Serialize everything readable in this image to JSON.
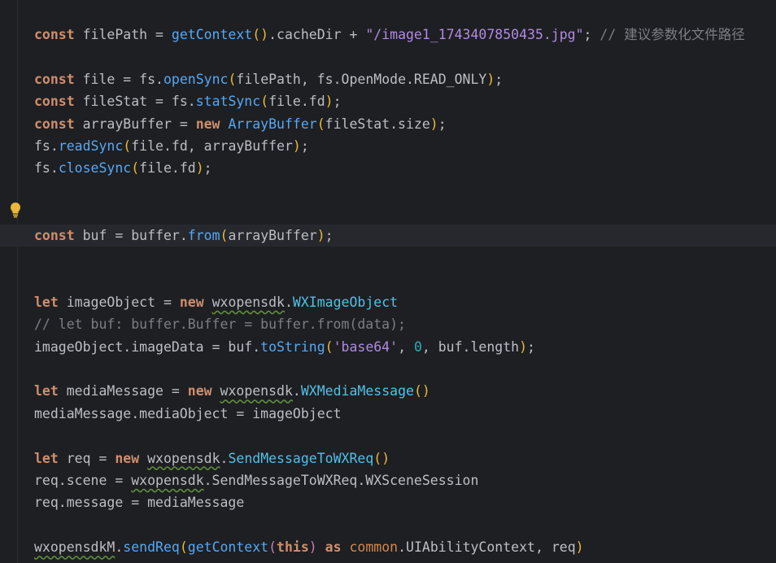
{
  "editor": {
    "lines": [
      {
        "tokens": [
          {
            "t": "const",
            "c": "kw"
          },
          {
            "t": " filePath ",
            "c": "ident"
          },
          {
            "t": "=",
            "c": "ident"
          },
          {
            "t": " ",
            "c": "ident"
          },
          {
            "t": "getContext",
            "c": "fn"
          },
          {
            "t": "()",
            "c": "yellowpar"
          },
          {
            "t": ".cacheDir ",
            "c": "ident"
          },
          {
            "t": "+",
            "c": "ident"
          },
          {
            "t": " ",
            "c": "ident"
          },
          {
            "t": "\"/image1_1743407850435.jpg\"",
            "c": "strpath"
          },
          {
            "t": "; ",
            "c": "ident"
          },
          {
            "t": "// 建议参数化文件路径",
            "c": "cmt"
          }
        ]
      },
      {
        "tokens": []
      },
      {
        "tokens": [
          {
            "t": "const",
            "c": "kw"
          },
          {
            "t": " file ",
            "c": "ident"
          },
          {
            "t": "=",
            "c": "ident"
          },
          {
            "t": " fs.",
            "c": "ident"
          },
          {
            "t": "openSync",
            "c": "fn"
          },
          {
            "t": "(",
            "c": "yellowpar"
          },
          {
            "t": "filePath, fs.OpenMode.READ_ONLY",
            "c": "ident"
          },
          {
            "t": ")",
            "c": "yellowpar"
          },
          {
            "t": ";",
            "c": "ident"
          }
        ]
      },
      {
        "tokens": [
          {
            "t": "const",
            "c": "kw"
          },
          {
            "t": " fileStat ",
            "c": "ident"
          },
          {
            "t": "=",
            "c": "ident"
          },
          {
            "t": " fs.",
            "c": "ident"
          },
          {
            "t": "statSync",
            "c": "fn"
          },
          {
            "t": "(",
            "c": "yellowpar"
          },
          {
            "t": "file.fd",
            "c": "ident"
          },
          {
            "t": ")",
            "c": "yellowpar"
          },
          {
            "t": ";",
            "c": "ident"
          }
        ]
      },
      {
        "tokens": [
          {
            "t": "const",
            "c": "kw"
          },
          {
            "t": " arrayBuffer ",
            "c": "ident"
          },
          {
            "t": "=",
            "c": "ident"
          },
          {
            "t": " ",
            "c": "ident"
          },
          {
            "t": "new",
            "c": "kw"
          },
          {
            "t": " ",
            "c": "ident"
          },
          {
            "t": "ArrayBuffer",
            "c": "fn"
          },
          {
            "t": "(",
            "c": "yellowpar"
          },
          {
            "t": "fileStat.size",
            "c": "ident"
          },
          {
            "t": ")",
            "c": "yellowpar"
          },
          {
            "t": ";",
            "c": "ident"
          }
        ]
      },
      {
        "tokens": [
          {
            "t": "fs.",
            "c": "ident"
          },
          {
            "t": "readSync",
            "c": "fn"
          },
          {
            "t": "(",
            "c": "yellowpar"
          },
          {
            "t": "file.fd, arrayBuffer",
            "c": "ident"
          },
          {
            "t": ")",
            "c": "yellowpar"
          },
          {
            "t": ";",
            "c": "ident"
          }
        ]
      },
      {
        "tokens": [
          {
            "t": "fs.",
            "c": "ident"
          },
          {
            "t": "closeSync",
            "c": "fn"
          },
          {
            "t": "(",
            "c": "yellowpar"
          },
          {
            "t": "file.fd",
            "c": "ident"
          },
          {
            "t": ")",
            "c": "yellowpar"
          },
          {
            "t": ";",
            "c": "ident"
          }
        ]
      },
      {
        "tokens": []
      },
      {
        "tokens": []
      },
      {
        "tokens": [
          {
            "t": "const",
            "c": "kw"
          },
          {
            "t": " buf ",
            "c": "ident"
          },
          {
            "t": "=",
            "c": "ident"
          },
          {
            "t": " buffer.",
            "c": "ident"
          },
          {
            "t": "from",
            "c": "fn"
          },
          {
            "t": "(",
            "c": "yellowpar"
          },
          {
            "t": "arrayBuffer",
            "c": "ident"
          },
          {
            "t": ")",
            "c": "yellowpar"
          },
          {
            "t": ";",
            "c": "ident"
          }
        ],
        "current": true
      },
      {
        "tokens": []
      },
      {
        "tokens": []
      },
      {
        "tokens": [
          {
            "t": "let",
            "c": "kw"
          },
          {
            "t": " imageObject ",
            "c": "ident"
          },
          {
            "t": "=",
            "c": "ident"
          },
          {
            "t": " ",
            "c": "ident"
          },
          {
            "t": "new",
            "c": "kw"
          },
          {
            "t": " ",
            "c": "ident"
          },
          {
            "t": "wxopensdk",
            "c": "wavy"
          },
          {
            "t": ".",
            "c": "ident"
          },
          {
            "t": "WXImageObject",
            "c": "cyanfn"
          }
        ]
      },
      {
        "tokens": [
          {
            "t": "// let buf: buffer.Buffer = buffer.from(data);",
            "c": "cmt"
          }
        ]
      },
      {
        "tokens": [
          {
            "t": "imageObject.imageData ",
            "c": "ident"
          },
          {
            "t": "=",
            "c": "ident"
          },
          {
            "t": " buf.",
            "c": "ident"
          },
          {
            "t": "toString",
            "c": "fn"
          },
          {
            "t": "(",
            "c": "yellowpar"
          },
          {
            "t": "'base64'",
            "c": "strpath"
          },
          {
            "t": ", ",
            "c": "ident"
          },
          {
            "t": "0",
            "c": "num"
          },
          {
            "t": ", buf.length",
            "c": "ident"
          },
          {
            "t": ")",
            "c": "yellowpar"
          },
          {
            "t": ";",
            "c": "ident"
          }
        ]
      },
      {
        "tokens": []
      },
      {
        "tokens": [
          {
            "t": "let",
            "c": "kw"
          },
          {
            "t": " mediaMessage ",
            "c": "ident"
          },
          {
            "t": "=",
            "c": "ident"
          },
          {
            "t": " ",
            "c": "ident"
          },
          {
            "t": "new",
            "c": "kw"
          },
          {
            "t": " ",
            "c": "ident"
          },
          {
            "t": "wxopensdk",
            "c": "wavy"
          },
          {
            "t": ".",
            "c": "ident"
          },
          {
            "t": "WXMediaMessage",
            "c": "cyanfn"
          },
          {
            "t": "()",
            "c": "yellowpar"
          }
        ]
      },
      {
        "tokens": [
          {
            "t": "mediaMessage.mediaObject ",
            "c": "ident"
          },
          {
            "t": "=",
            "c": "ident"
          },
          {
            "t": " imageObject",
            "c": "ident"
          }
        ]
      },
      {
        "tokens": []
      },
      {
        "tokens": [
          {
            "t": "let",
            "c": "kw"
          },
          {
            "t": " req ",
            "c": "ident"
          },
          {
            "t": "=",
            "c": "ident"
          },
          {
            "t": " ",
            "c": "ident"
          },
          {
            "t": "new",
            "c": "kw"
          },
          {
            "t": " ",
            "c": "ident"
          },
          {
            "t": "wxopensdk",
            "c": "wavy"
          },
          {
            "t": ".",
            "c": "ident"
          },
          {
            "t": "SendMessageToWXReq",
            "c": "cyanfn"
          },
          {
            "t": "()",
            "c": "yellowpar"
          }
        ]
      },
      {
        "tokens": [
          {
            "t": "req.scene ",
            "c": "ident"
          },
          {
            "t": "=",
            "c": "ident"
          },
          {
            "t": " ",
            "c": "ident"
          },
          {
            "t": "wxopensdk",
            "c": "wavy"
          },
          {
            "t": ".SendMessageToWXReq.WXSceneSession",
            "c": "ident"
          }
        ]
      },
      {
        "tokens": [
          {
            "t": "req.message ",
            "c": "ident"
          },
          {
            "t": "=",
            "c": "ident"
          },
          {
            "t": " mediaMessage",
            "c": "ident"
          }
        ]
      },
      {
        "tokens": []
      },
      {
        "tokens": [
          {
            "t": "wxopensdkM",
            "c": "wavy"
          },
          {
            "t": ".",
            "c": "ident"
          },
          {
            "t": "sendReq",
            "c": "fn"
          },
          {
            "t": "(",
            "c": "yellowpar"
          },
          {
            "t": "getContext",
            "c": "fn"
          },
          {
            "t": "(",
            "c": "purple"
          },
          {
            "t": "this",
            "c": "kw"
          },
          {
            "t": ")",
            "c": "purple"
          },
          {
            "t": " ",
            "c": "ident"
          },
          {
            "t": "as",
            "c": "kw"
          },
          {
            "t": " ",
            "c": "ident"
          },
          {
            "t": "common",
            "c": "commonpkg"
          },
          {
            "t": ".UIAbilityContext, req",
            "c": "ident"
          },
          {
            "t": ")",
            "c": "yellowpar"
          }
        ]
      }
    ]
  },
  "gutter": {
    "bulb_icon": "intention-bulb-icon"
  },
  "colors": {
    "background": "#1e1f22",
    "keyword": "#cf8e6d",
    "function": "#56a8f5",
    "string": "#b18ae3",
    "comment": "#7a7e85",
    "number": "#2aacb8",
    "default": "#bcbec4",
    "current_line": "#26282e",
    "bulb": "#e8b73b"
  }
}
